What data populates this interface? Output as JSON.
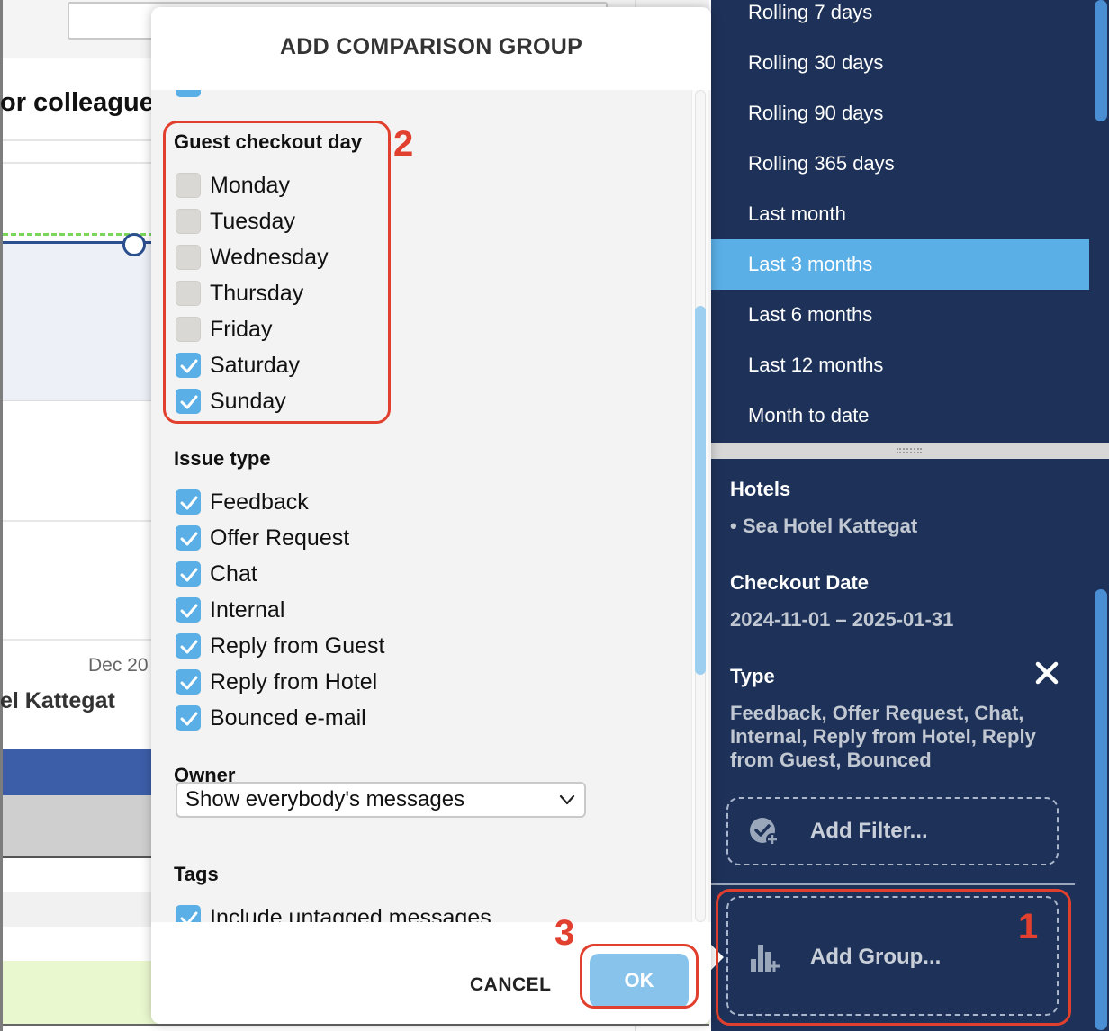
{
  "background": {
    "heading_fragment": "or colleagues",
    "axis_label_fragment": "Dec 20",
    "hotel_label_fragment": "el Kattegat",
    "colors": {
      "series": "#2c4f8f",
      "target": "#7ad65a",
      "band_blue": "#3c5da8"
    }
  },
  "sidebar": {
    "date_ranges": [
      {
        "label": "Rolling 7 days",
        "active": false
      },
      {
        "label": "Rolling 30 days",
        "active": false
      },
      {
        "label": "Rolling 90 days",
        "active": false
      },
      {
        "label": "Rolling 365 days",
        "active": false
      },
      {
        "label": "Last month",
        "active": false
      },
      {
        "label": "Last 3 months",
        "active": true
      },
      {
        "label": "Last 6 months",
        "active": false
      },
      {
        "label": "Last 12 months",
        "active": false
      },
      {
        "label": "Month to date",
        "active": false
      }
    ],
    "hotels": {
      "title": "Hotels",
      "value": "• Sea Hotel Kattegat"
    },
    "checkout": {
      "title": "Checkout Date",
      "value": "2024-11-01 – 2025-01-31"
    },
    "type": {
      "title": "Type",
      "value_lines": [
        "Feedback, Offer Request, Chat,",
        "Internal, Reply from Hotel, Reply",
        "from Guest, Bounced"
      ]
    },
    "add_filter_label": "Add Filter...",
    "add_group_label": "Add Group...",
    "colors": {
      "background": "#1e3259",
      "active": "#5aafe6"
    }
  },
  "modal": {
    "title": "ADD COMPARISON GROUP",
    "checkout_day": {
      "title": "Guest checkout day",
      "options": [
        {
          "label": "Monday",
          "checked": false
        },
        {
          "label": "Tuesday",
          "checked": false
        },
        {
          "label": "Wednesday",
          "checked": false
        },
        {
          "label": "Thursday",
          "checked": false
        },
        {
          "label": "Friday",
          "checked": false
        },
        {
          "label": "Saturday",
          "checked": true
        },
        {
          "label": "Sunday",
          "checked": true
        }
      ]
    },
    "issue_type": {
      "title": "Issue type",
      "options": [
        {
          "label": "Feedback",
          "checked": true
        },
        {
          "label": "Offer Request",
          "checked": true
        },
        {
          "label": "Chat",
          "checked": true
        },
        {
          "label": "Internal",
          "checked": true
        },
        {
          "label": "Reply from Guest",
          "checked": true
        },
        {
          "label": "Reply from Hotel",
          "checked": true
        },
        {
          "label": "Bounced e-mail",
          "checked": true
        }
      ]
    },
    "owner": {
      "title": "Owner",
      "selected": "Show everybody's messages"
    },
    "tags": {
      "title": "Tags",
      "options": [
        {
          "label": "Include untagged messages",
          "checked": true
        }
      ]
    },
    "cancel_label": "CANCEL",
    "ok_label": "OK",
    "colors": {
      "checkbox_checked": "#5aafe6",
      "ok_button": "#88c3ec"
    }
  },
  "annotations": {
    "step1": "1",
    "step2": "2",
    "step3": "3",
    "color": "#e2402e"
  }
}
